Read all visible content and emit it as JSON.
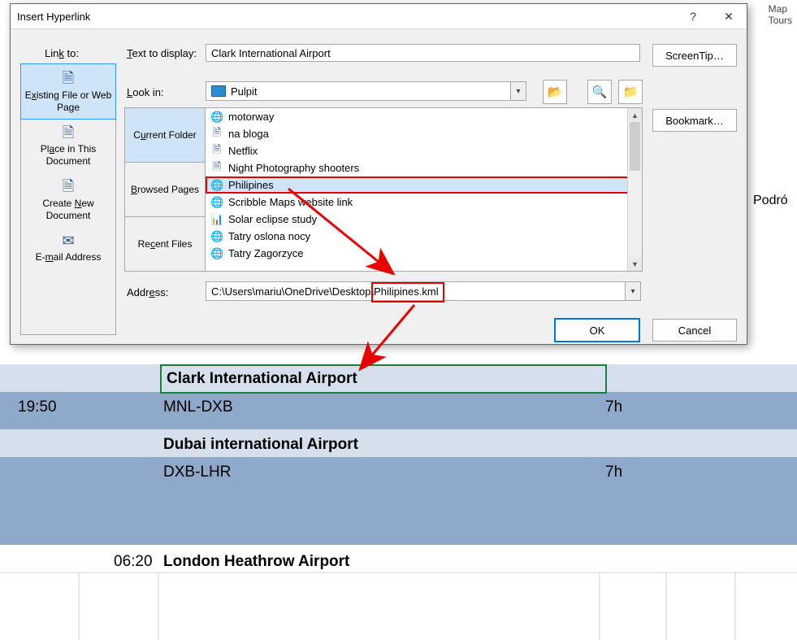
{
  "ribbon_rem": {
    "line1": "Map",
    "line2": "Tours"
  },
  "sheet_side": "Podró",
  "dialog": {
    "title": "Insert Hyperlink",
    "help_glyph": "?",
    "close_glyph": "✕",
    "linkto_label_pre": "Lin",
    "linkto_label_u": "k",
    "linkto_label_post": " to:",
    "linkto": {
      "opts": [
        {
          "icon": "🗎",
          "pre": "E",
          "u": "x",
          "post": "isting File or Web Page",
          "sel": true
        },
        {
          "icon": "🗎",
          "pre": "Pl",
          "u": "a",
          "post": "ce in This Document",
          "sel": false
        },
        {
          "icon": "🗎",
          "pre": "Create ",
          "u": "N",
          "post": "ew Document",
          "sel": false
        },
        {
          "icon": "✉",
          "pre": "E-",
          "u": "m",
          "post": "ail Address",
          "sel": false
        }
      ]
    },
    "ttd": {
      "label_u": "T",
      "label_post": "ext to display:",
      "value": "Clark International Airport"
    },
    "lookin": {
      "label_u": "L",
      "label_post": "ook in:",
      "value": "Pulpit"
    },
    "icon_buttons": {
      "up": "📂",
      "web": "🔍",
      "new": "📁"
    },
    "tabs": [
      {
        "pre": "C",
        "u": "u",
        "post": "rrent Folder",
        "sel": true
      },
      {
        "pre": "",
        "u": "B",
        "post": "rowsed Pages",
        "sel": false
      },
      {
        "pre": "Re",
        "u": "c",
        "post": "ent Files",
        "sel": false
      }
    ],
    "files": [
      {
        "icon": "🌐",
        "name": "motorway"
      },
      {
        "icon": "🗎",
        "name": "na bloga"
      },
      {
        "icon": "🗎",
        "name": "Netflix"
      },
      {
        "icon": "🗎",
        "name": "Night Photography shooters"
      },
      {
        "icon": "🌐",
        "name": "Philipines",
        "sel": true,
        "hl": true
      },
      {
        "icon": "🌐",
        "name": "Scribble Maps website link"
      },
      {
        "icon": "📊",
        "name": "Solar eclipse study"
      },
      {
        "icon": "🌐",
        "name": "Tatry oslona nocy"
      },
      {
        "icon": "🌐",
        "name": "Tatry Zagorzyce"
      }
    ],
    "addr": {
      "label_pre": "Addr",
      "label_u": "e",
      "label_post": "ss:",
      "prefix": "C:\\Users\\mariu\\OneDrive\\Desktop\\",
      "file": "Philipines.kml"
    },
    "screentip_label": "ScreenTip…",
    "bookmark_label": "Bookmark…",
    "ok_label": "OK",
    "cancel_label": "Cancel"
  },
  "sheet": {
    "row1_airport": "Clark International Airport",
    "row2_time": "19:50",
    "row2_route": "MNL-DXB",
    "row2_dur": "7h",
    "row3_airport": "Dubai international Airport",
    "row4_route": "DXB-LHR",
    "row4_dur": "7h",
    "row5_time": "06:20",
    "row5_airport": "London Heathrow Airport"
  }
}
